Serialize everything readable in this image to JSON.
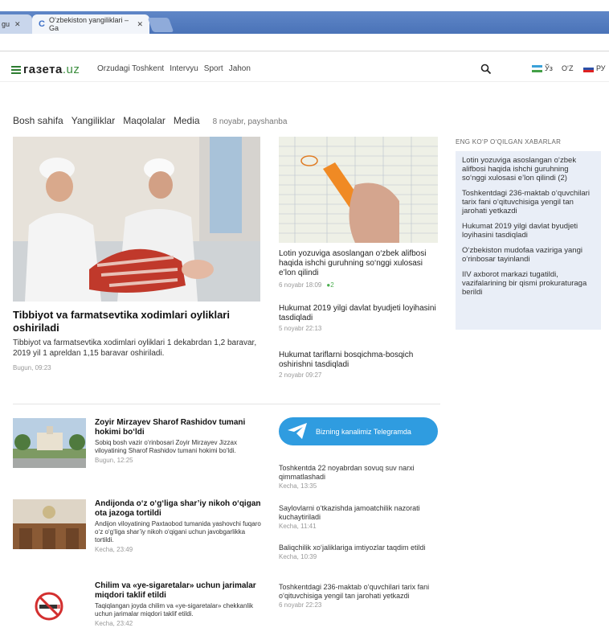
{
  "browser": {
    "tab_prev": "gu",
    "tab_active": "O‘zbekiston yangiliklari – Ga",
    "close": "✕"
  },
  "site": {
    "logo_main": "газета",
    "logo_tld": ".uz",
    "nav": [
      "Orzudagi Toshkent",
      "Intervyu",
      "Sport",
      "Jahon"
    ],
    "lang_uz_cyr": "Ўз",
    "lang_uz_lat": "O‘Z",
    "lang_ru": "РУ"
  },
  "breadcrumbs": {
    "items": [
      "Bosh sahifa",
      "Yangiliklar",
      "Maqolalar",
      "Media"
    ],
    "date": "8 noyabr, payshanba"
  },
  "main_story": {
    "title": "Tibbiyot va farmatsevtika xodimlari oyliklari oshiriladi",
    "lead": "Tibbiyot va farmatsevtika xodimlari oyliklari 1 dekabrdan 1,2 baravar, 2019 yil 1 apreldan 1,15 baravar oshiriladi.",
    "time": "Bugun, 09:23"
  },
  "second_story": {
    "title": "Lotin yozuviga asoslangan o‘zbek alifbosi haqida ishchi guruhning so‘nggi xulosasi e’lon qilindi",
    "time": "6 noyabr 18:09",
    "comments": "2"
  },
  "mid_list": [
    {
      "title": "Hukumat 2019 yilgi davlat byudjeti loyihasini tasdiqladi",
      "time": "5 noyabr 22:13"
    },
    {
      "title": "Hukumat tariflarni bosqichma-bosqich oshirishni tasdiqladi",
      "time": "2 noyabr 09:27"
    }
  ],
  "popular": {
    "heading": "ENG KO‘P O‘QILGAN XABARLAR",
    "items": [
      "Lotin yozuviga asoslangan o‘zbek alifbosi haqida ishchi guruhning so‘nggi xulosasi e’lon qilindi (2)",
      "Toshkentdagi 236-maktab o‘quvchilari tarix fani o‘qituvchisiga yengil tan jarohati yetkazdi",
      "Hukumat 2019 yilgi davlat byudjeti loyihasini tasdiqladi",
      "O‘zbekiston mudofaa vaziriga yangi o‘rinbosar tayinlandi",
      "IIV axborot markazi tugatildi, vazifalarining bir qismi prokuraturaga berildi"
    ]
  },
  "lower_list": [
    {
      "title": "Zoyir Mirzayev Sharof Rashidov tumani hokimi bo‘ldi",
      "desc": "Sobiq bosh vazir o‘rinbosari Zoyir Mirzayev Jizzax viloyatining Sharof Rashidov tumani hokimi bo‘ldi.",
      "time": "Bugun, 12:25"
    },
    {
      "title": "Andijonda o‘z o‘g‘liga shar’iy nikoh o‘qigan ota jazoga tortildi",
      "desc": "Andijon viloyatining Paxtaobod tumanida yashovchi fuqaro o‘z o‘g‘liga shar’iy nikoh o‘qigani uchun javobgarlikka tortildi.",
      "time": "Kecha, 23:49"
    },
    {
      "title": "Chilim va «ye-sigaretalar» uchun jarimalar miqdori taklif etildi",
      "desc": "Taqiqlangan joyda chilim va «ye-sigaretalar» chekkanlik uchun jarimalar miqdori taklif etildi.",
      "time": "Kecha, 23:42"
    }
  ],
  "telegram": {
    "label": "Bizning kanalimiz Telegramda"
  },
  "right_news": [
    {
      "title": "Toshkentda 22 noyabrdan sovuq suv narxi qimmatlashadi",
      "time": "Kecha, 13:35"
    },
    {
      "title": "Saylovlarni o‘tkazishda jamoatchilik nazorati kuchaytiriladi",
      "time": "Kecha, 11:41"
    },
    {
      "title": "Baliqchilik xo‘jaliklariga imtiyozlar taqdim etildi",
      "time": "Kecha, 10:39"
    },
    {
      "title": "Toshkentdagi 236-maktab o‘quvchilari tarix fani o‘qituvchisiga yengil tan jarohati yetkazdi",
      "time": "6 noyabr 22:23"
    }
  ],
  "colors": {
    "chrome_blue": "#4a73b8",
    "accent_green": "#3b8e3e",
    "telegram": "#2f9ce0",
    "popular_bg": "#e9eef7"
  }
}
